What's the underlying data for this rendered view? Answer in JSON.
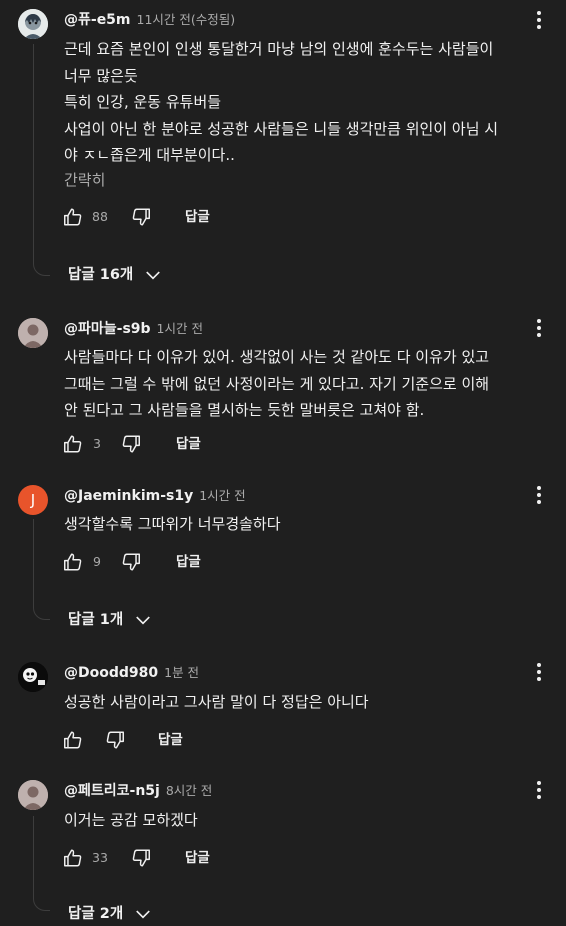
{
  "comments": [
    {
      "author": "@퓨-e5m",
      "time": "11시간 전(수정됨)",
      "lines": [
        "근데 요즘 본인이 인생 통달한거 마냥 남의 인생에 훈수두는 사람들이",
        "너무 많은듯",
        "특히 인강, 운동 유튜버들",
        "사업이 아닌 한 분야로 성공한 사람들은 니들 생각만큼 위인이 아님 시",
        "야 ㅈㄴ좁은게 대부분이다.."
      ],
      "read_more": "간략히",
      "likes": "88",
      "reply_label": "답글",
      "replies_label": "답글 16개"
    },
    {
      "author": "@파마늘-s9b",
      "time": "1시간 전",
      "lines": [
        "사람들마다 다 이유가 있어. 생각없이 사는 것 같아도 다 이유가 있고",
        "그때는 그럴 수 밖에 없던 사정이라는 게 있다고.  자기 기준으로 이해",
        "안 된다고 그 사람들을 멸시하는 듯한 말버릇은 고쳐야 함."
      ],
      "likes": "3",
      "reply_label": "답글"
    },
    {
      "author": "@Jaeminkim-s1y",
      "time": "1시간 전",
      "avatar_letter": "J",
      "lines": [
        "생각할수록 그따위가 너무경솔하다"
      ],
      "likes": "9",
      "reply_label": "답글",
      "replies_label": "답글 1개"
    },
    {
      "author": "@Doodd980",
      "time": "1분 전",
      "lines": [
        "성공한 사람이라고 그사람 말이 다 정답은 아니다"
      ],
      "likes": "",
      "reply_label": "답글"
    },
    {
      "author": "@페트리코-n5j",
      "time": "8시간 전",
      "lines": [
        "이거는 공감 모하겠다"
      ],
      "likes": "33",
      "reply_label": "답글",
      "replies_label": "답글 2개"
    }
  ],
  "colors": {
    "background": "#1f1f1f",
    "text_primary": "#f1f1f1",
    "text_secondary": "#aaaaaa",
    "avatar_j": "#e8542b",
    "thread_line": "#3d3d3d"
  },
  "icons": {
    "like": "thumbs-up-icon",
    "dislike": "thumbs-down-icon",
    "more": "more-vert-icon",
    "expand": "chevron-down-icon"
  }
}
